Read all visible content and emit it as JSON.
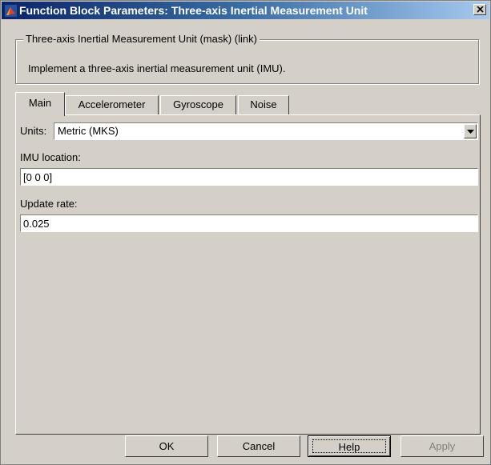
{
  "window": {
    "title": "Function Block Parameters: Three-axis Inertial Measurement Unit",
    "close_glyph": "×"
  },
  "mask": {
    "legend": "Three-axis Inertial Measurement Unit (mask) (link)",
    "description": "Implement a three-axis inertial measurement unit (IMU)."
  },
  "tabs": [
    {
      "label": "Main",
      "active": true
    },
    {
      "label": "Accelerometer",
      "active": false
    },
    {
      "label": "Gyroscope",
      "active": false
    },
    {
      "label": "Noise",
      "active": false
    }
  ],
  "params": {
    "units_label": "Units:",
    "units_value": "Metric (MKS)",
    "imu_location_label": "IMU location:",
    "imu_location_value": "[0 0 0]",
    "update_rate_label": "Update rate:",
    "update_rate_value": "0.025"
  },
  "buttons": {
    "ok": "OK",
    "cancel": "Cancel",
    "help": "Help",
    "apply": "Apply"
  },
  "icons": {
    "app": "simulink-block-icon",
    "close": "close-icon",
    "dropdown": "chevron-down-icon"
  },
  "colors": {
    "titlebar_start": "#0a246a",
    "titlebar_end": "#a6caf0",
    "face": "#d4d0c8"
  }
}
